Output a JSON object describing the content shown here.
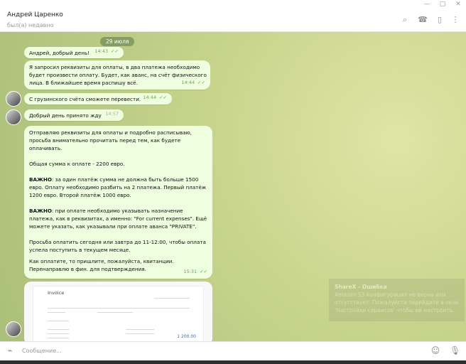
{
  "window": {
    "minimize": "—",
    "maximize": "□",
    "close": "✕"
  },
  "header": {
    "title": "Андрей Царенко",
    "status": "был(а) недавно",
    "icons": [
      "search-icon",
      "phone-icon",
      "sidebar-icon",
      "more-icon"
    ]
  },
  "chat": {
    "date": "29 июля",
    "messages": [
      {
        "text": "Андрей, добрый день!",
        "time": "14:43"
      },
      {
        "text": "Я запросил реквизиты для оплаты, в два платежа необходимо будет произвести оплату. Будет, как аванс, на счёт физического лица. В ближайшее время распишу всё.",
        "time": "14:44"
      },
      {
        "text": "С грузинского счёта сможете перевести.",
        "time": "14:44"
      },
      {
        "text": "Добрый день принято жду",
        "time": "14:57"
      },
      {
        "text": "Отправляю реквизиты для оплаты и подробно расписываю, просьба внимательно прочитать перед тем, как будете оплачивать.",
        "time": ""
      }
    ],
    "long_message": {
      "p1": "Общая сумма к оплате - 2200 евро.",
      "p2b": "ВАЖНО",
      "p2": ": за один платёж сумма не должна быть больше 1500 евро. Оплату необходимо разбить на 2 платежа. Первый платёж 1200 евро. Второй платёж 1000 евро.",
      "p3b": "ВАЖНО",
      "p3": ": при оплате необходимо указывать назначение платежа, как в реквизитах, а именно: \"For current expenses\". Ещё можете указать, как указывали при оплате аванса \"PRIVATE\".",
      "p4": "Просьба оплатить сегодня или завтра до 11-12:00, чтобы оплата успела поступить в текущем месяце.",
      "p5": "Как оплатите, то пришлите, пожалуйста, квитанции. Перенаправлю в фин. для подтверждения.",
      "time": "15:31"
    },
    "invoice": {
      "title": "Invoice",
      "total": "1 200.00"
    }
  },
  "sharex": {
    "title": "ShareX - Ошибка",
    "text": "Amazon S3 конфигурация не верна или отсутствует. Пожалуйста перейдите в окно 'Настройки сервисов' чтобы её настроить."
  },
  "input": {
    "placeholder": "Сообщение..."
  }
}
